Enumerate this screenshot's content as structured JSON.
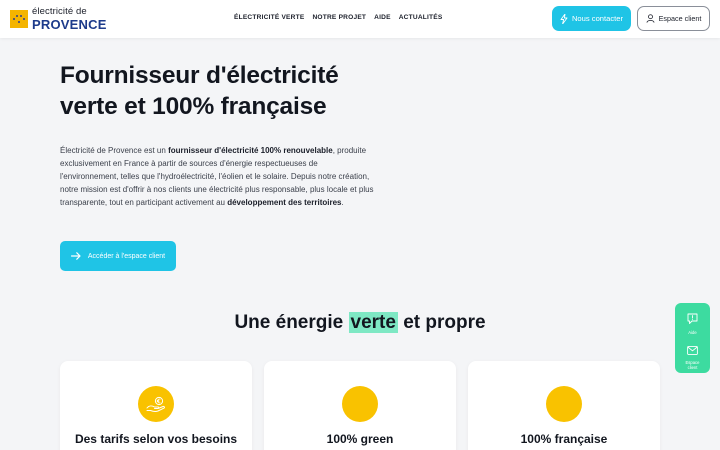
{
  "brand": {
    "line1": "électricité de",
    "line2": "PROVENCE"
  },
  "nav": {
    "items": [
      {
        "label": "ÉLECTRICITÉ VERTE"
      },
      {
        "label": "NOTRE PROJET"
      },
      {
        "label": "AIDE"
      },
      {
        "label": "ACTUALITÉS"
      }
    ]
  },
  "header": {
    "contact_label": "Nous contacter",
    "client_label": "Espace client"
  },
  "hero": {
    "title_line1": "Fournisseur d'électricité",
    "title_line2": "verte et 100% française",
    "p1": "Électricité de Provence est un ",
    "b1": "fournisseur d'électricité 100% renouvelable",
    "p2": ", produite exclusivement en France à partir de sources d'énergie respectueuses de l'environnement, telles que l'hydroélectricité, l'éolien et le solaire. Depuis notre création, notre mission est d'offrir à nos clients une électricité plus responsable, plus locale et plus transparente, tout en participant activement au ",
    "b2": "développement des territoires",
    "p3": ".",
    "cta_label": "Accéder à l'espace client"
  },
  "section": {
    "title_pre": "Une énergie ",
    "title_highlight": "verte",
    "title_post": " et propre"
  },
  "cards": [
    {
      "title": "Des tarifs selon vos besoins",
      "icon": "hand-euro-icon"
    },
    {
      "title": "100% green",
      "icon": ""
    },
    {
      "title": "100% française",
      "icon": ""
    }
  ],
  "side": {
    "help_label": "Aide",
    "client_line1": "Espace",
    "client_line2": "client"
  },
  "colors": {
    "accent": "#1fc4e6",
    "highlight": "#7ee8c4",
    "side_widget": "#3ddba0",
    "icon_circle": "#f9c200",
    "logo_yellow": "#f4b400",
    "logo_blue": "#1d3b8b"
  }
}
